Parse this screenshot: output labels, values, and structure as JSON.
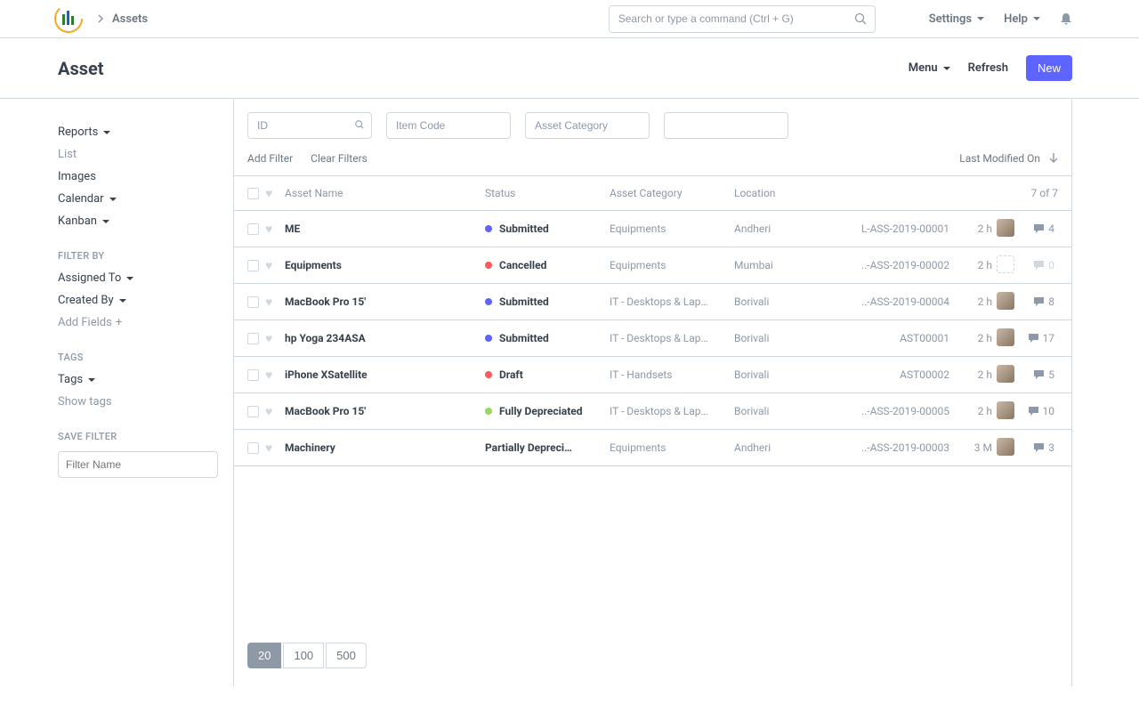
{
  "header": {
    "breadcrumb": "Assets",
    "search_placeholder": "Search or type a command (Ctrl + G)",
    "settings": "Settings",
    "help": "Help"
  },
  "page": {
    "title": "Asset",
    "menu": "Menu",
    "refresh": "Refresh",
    "new": "New"
  },
  "sidebar": {
    "reports": "Reports",
    "list": "List",
    "images": "Images",
    "calendar": "Calendar",
    "kanban": "Kanban",
    "filter_by": "FILTER BY",
    "assigned_to": "Assigned To",
    "created_by": "Created By",
    "add_fields": "Add Fields",
    "tags_heading": "TAGS",
    "tags": "Tags",
    "show_tags": "Show tags",
    "save_filter": "SAVE FILTER",
    "filter_name_placeholder": "Filter Name"
  },
  "filters": {
    "id_placeholder": "ID",
    "item_code_placeholder": "Item Code",
    "asset_category_placeholder": "Asset Category",
    "add_filter": "Add Filter",
    "clear_filters": "Clear Filters",
    "sort": "Last Modified On"
  },
  "table": {
    "head": {
      "name": "Asset Name",
      "status": "Status",
      "category": "Asset Category",
      "location": "Location",
      "count": "7 of 7"
    },
    "rows": [
      {
        "name": "ME",
        "status": "Submitted",
        "status_color": "#5e64ff",
        "category": "Equipments",
        "location": "Andheri",
        "id": "L-ASS-2019-00001",
        "age": "2 h",
        "comments": "4",
        "avatar": "a"
      },
      {
        "name": "Equipments",
        "status": "Cancelled",
        "status_color": "#ff5858",
        "category": "Equipments",
        "location": "Mumbai",
        "id": "..-ASS-2019-00002",
        "age": "2 h",
        "comments": "0",
        "avatar": "dashed"
      },
      {
        "name": "MacBook Pro 15'",
        "status": "Submitted",
        "status_color": "#5e64ff",
        "category": "IT - Desktops & Lap…",
        "location": "Borivali",
        "id": "..-ASS-2019-00004",
        "age": "2 h",
        "comments": "8",
        "avatar": "b"
      },
      {
        "name": "hp Yoga 234ASA",
        "status": "Submitted",
        "status_color": "#5e64ff",
        "category": "IT - Desktops & Lap…",
        "location": "Borivali",
        "id": "AST00001",
        "age": "2 h",
        "comments": "17",
        "avatar": "c"
      },
      {
        "name": "iPhone XSatellite",
        "status": "Draft",
        "status_color": "#ff5858",
        "category": "IT - Handsets",
        "location": "Borivali",
        "id": "AST00002",
        "age": "2 h",
        "comments": "5",
        "avatar": "d"
      },
      {
        "name": "MacBook Pro 15'",
        "status": "Fully Depreciated",
        "status_color": "#98d85b",
        "category": "IT - Desktops & Lap…",
        "location": "Borivali",
        "id": "..-ASS-2019-00005",
        "age": "2 h",
        "comments": "10",
        "avatar": "e"
      },
      {
        "name": "Machinery",
        "status": "Partially Depreci…",
        "status_color": "",
        "category": "Equipments",
        "location": "Andheri",
        "id": "..-ASS-2019-00003",
        "age": "3 M",
        "comments": "3",
        "avatar": "f"
      }
    ]
  },
  "pager": {
    "p20": "20",
    "p100": "100",
    "p500": "500"
  }
}
